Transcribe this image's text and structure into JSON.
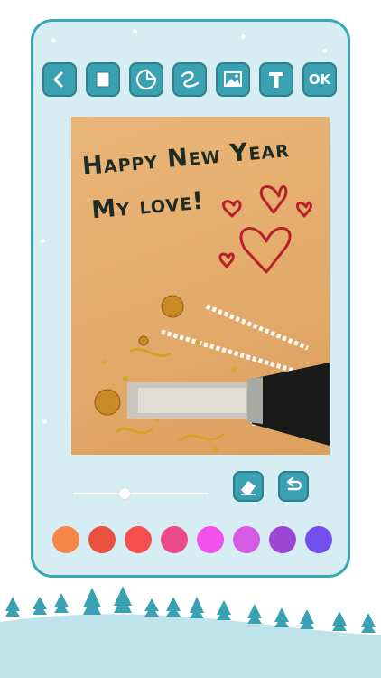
{
  "toolbar": {
    "back_icon": "back-arrow-icon",
    "frame_icon": "frame-icon",
    "sticker_icon": "sticker-icon",
    "draw_icon": "draw-icon",
    "image_icon": "image-icon",
    "text_icon": "text-icon",
    "ok_label": "OK"
  },
  "card": {
    "line1": "Happy New Year",
    "line2": "My love!"
  },
  "brush": {
    "size_fraction": 0.38
  },
  "tools": {
    "eraser_icon": "eraser-icon",
    "undo_icon": "undo-icon"
  },
  "palette": {
    "colors": [
      "#f5874d",
      "#e9513f",
      "#f54f4f",
      "#ed4a8c",
      "#f050ec",
      "#d55be4",
      "#9b46d4",
      "#7350ee"
    ]
  },
  "colors": {
    "accent": "#3aa1b3",
    "panel_bg": "#d6eef3",
    "heart": "#b8202b"
  }
}
